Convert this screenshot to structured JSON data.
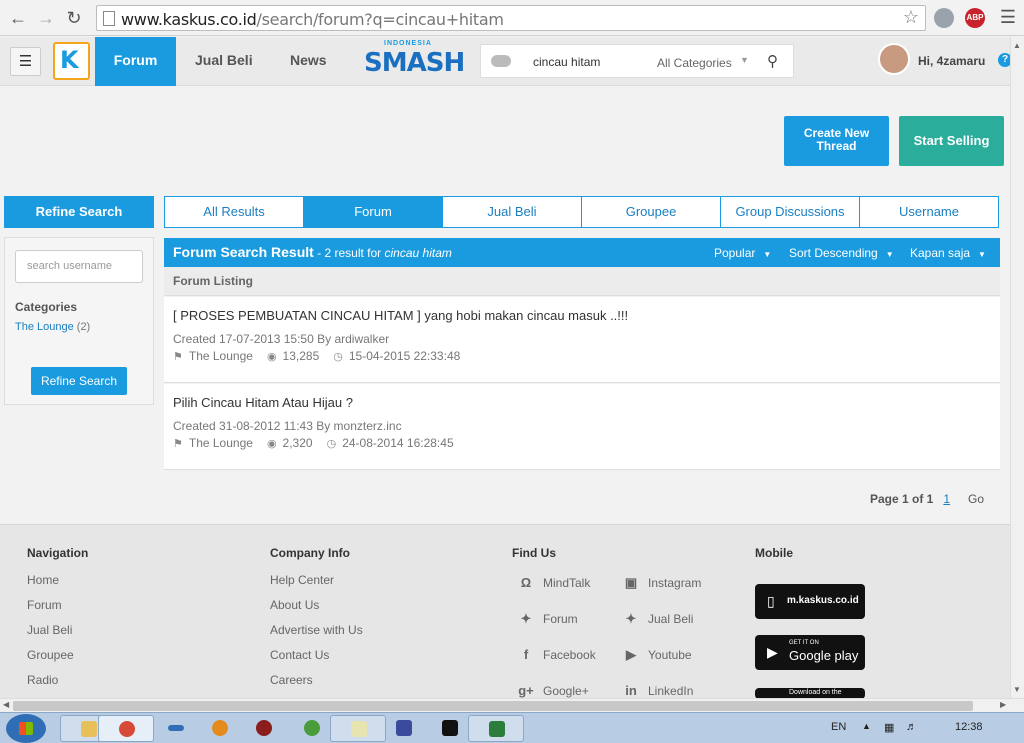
{
  "browser": {
    "url_host": "www.kaskus.co.id",
    "url_path": "/search/forum?q=cincau+hitam",
    "ext_label": "ABP"
  },
  "header": {
    "nav": [
      "Forum",
      "Jual Beli",
      "News"
    ],
    "promo_small": "INDONESIA",
    "promo_big": "SMASH",
    "search_query": "cincau hitam",
    "search_category": "All Categories",
    "greeting": "Hi, 4zamaru"
  },
  "actions": {
    "create_thread": "Create New Thread",
    "start_selling": "Start Selling"
  },
  "sidebar": {
    "title": "Refine Search",
    "username_placeholder": "search username",
    "categories_heading": "Categories",
    "category": {
      "label": "The Lounge",
      "count": "(2)"
    },
    "refine_button": "Refine Search"
  },
  "tabs": [
    "All Results",
    "Forum",
    "Jual Beli",
    "Groupee",
    "Group Discussions",
    "Username"
  ],
  "results": {
    "title": "Forum Search Result",
    "summary_prefix": " - 2 result for ",
    "query": "cincau hitam",
    "sort_popular": "Popular",
    "sort_order": "Sort Descending",
    "time_filter": "Kapan saja",
    "listing_heading": "Forum Listing",
    "threads": [
      {
        "title": "[ PROSES PEMBUATAN CINCAU HITAM ] yang hobi makan cincau masuk ..!!!",
        "meta": "Created 17-07-2013 15:50 By ardiwalker",
        "category": "The Lounge",
        "views": "13,285",
        "last": "15-04-2015 22:33:48"
      },
      {
        "title": "Pilih Cincau Hitam Atau Hijau ?",
        "meta": "Created 31-08-2012 11:43 By monzterz.inc",
        "category": "The Lounge",
        "views": "2,320",
        "last": "24-08-2014 16:28:45"
      }
    ],
    "page_label": "Page 1 of 1",
    "page_num": "1",
    "go": "Go"
  },
  "footer": {
    "navigation": {
      "heading": "Navigation",
      "links": [
        "Home",
        "Forum",
        "Jual Beli",
        "Groupee",
        "Radio"
      ]
    },
    "company": {
      "heading": "Company Info",
      "links": [
        "Help Center",
        "About Us",
        "Advertise with Us",
        "Contact Us",
        "Careers"
      ]
    },
    "find_us": {
      "heading": "Find Us",
      "left": [
        "MindTalk",
        "Forum",
        "Facebook",
        "Google+"
      ],
      "right": [
        "Instagram",
        "Jual Beli",
        "Youtube",
        "LinkedIn"
      ]
    },
    "mobile": {
      "heading": "Mobile",
      "mobile_site": "m.kaskus.co.id",
      "google_small": "GET IT ON",
      "google_big": "Google play",
      "appstore": "Download on the"
    }
  },
  "taskbar": {
    "lang": "EN",
    "clock": "12:38"
  },
  "colors": {
    "accent": "#1a9be0",
    "sell": "#2aad9a",
    "logo_border": "#f7a41d"
  }
}
